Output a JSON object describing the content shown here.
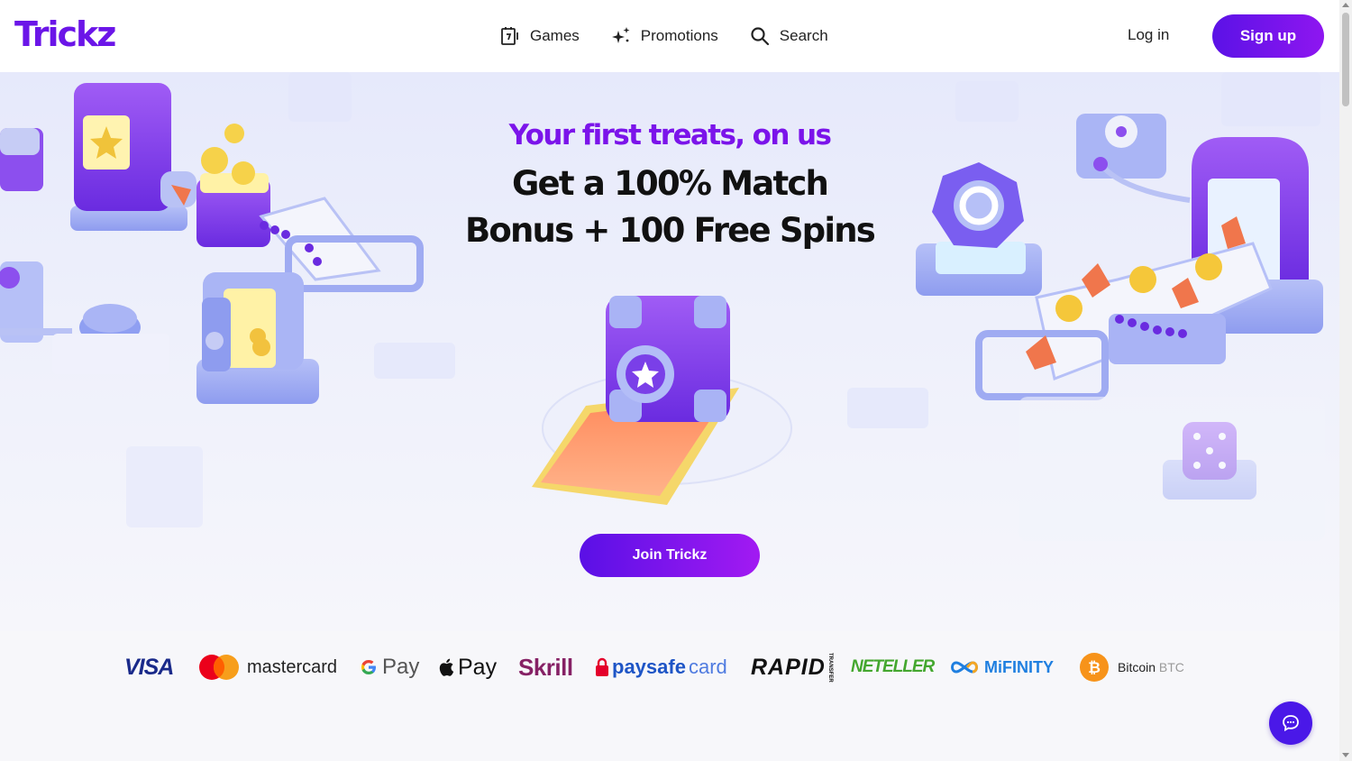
{
  "header": {
    "logo": "Trickz",
    "nav": [
      {
        "label": "Games",
        "icon": "slot-machine-icon"
      },
      {
        "label": "Promotions",
        "icon": "sparkles-icon"
      },
      {
        "label": "Search",
        "icon": "search-icon"
      }
    ],
    "login_label": "Log in",
    "signup_label": "Sign up"
  },
  "hero": {
    "tagline": "Your first treats, on us",
    "headline_line1": "Get a 100% Match",
    "headline_line2": "Bonus + 100 Free Spins",
    "cta_label": "Join Trickz"
  },
  "payments": {
    "visa": "VISA",
    "mastercard": "mastercard",
    "google_pay": "Pay",
    "apple_pay": "Pay",
    "skrill": "Skrill",
    "paysafecard_a": "paysafe",
    "paysafecard_b": "card",
    "rapid": "RAPID",
    "rapid_sub": "TRANSFER",
    "neteller": "NETELLER",
    "mifinity": "MiFINITY",
    "bitcoin_name": "Bitcoin",
    "bitcoin_symbol": "BTC"
  },
  "colors": {
    "brand_purple": "#6b15e8",
    "button_gradient_start": "#5b12e6",
    "button_gradient_end": "#8e16f0",
    "chat_button": "#4a18e8"
  },
  "chat": {
    "icon": "chat-bubble-icon"
  }
}
